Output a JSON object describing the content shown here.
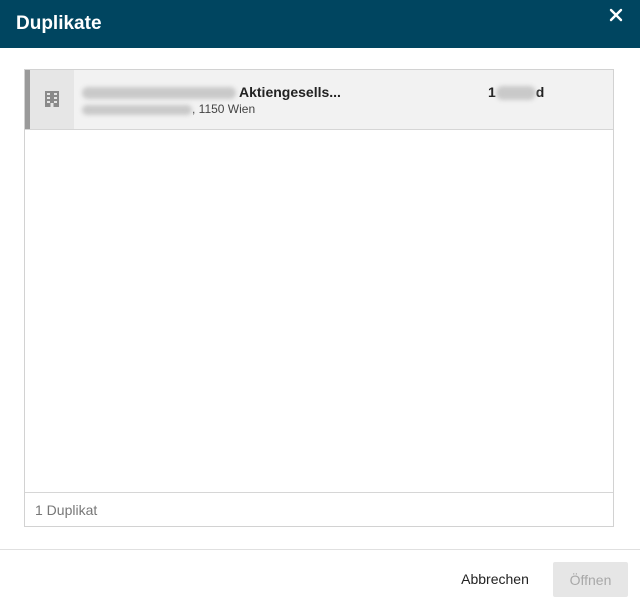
{
  "dialog": {
    "title": "Duplikate",
    "close_icon": "close-icon",
    "accent_color": "#004560"
  },
  "results": {
    "items": [
      {
        "icon": "building-icon",
        "name_visible": "Aktiengesells...",
        "address_visible": ", 1150 Wien",
        "number_prefix": "1",
        "number_suffix": "d"
      }
    ],
    "count_label": "1 Duplikat"
  },
  "actions": {
    "cancel_label": "Abbrechen",
    "open_label": "Öffnen",
    "open_enabled": false
  }
}
